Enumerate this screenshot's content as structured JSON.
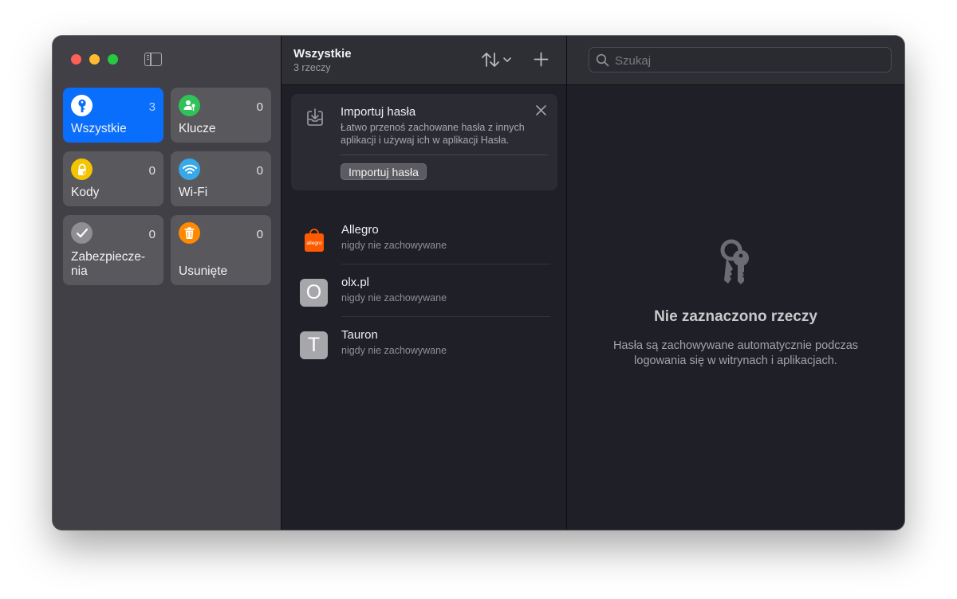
{
  "sidebar": {
    "tiles": [
      {
        "label": "Wszystkie",
        "count": "3",
        "icon": "key-icon",
        "color": "#0a6efc"
      },
      {
        "label": "Klucze",
        "count": "0",
        "icon": "passkey-person-icon",
        "color": "#30c259"
      },
      {
        "label": "Kody",
        "count": "0",
        "icon": "lock-icon",
        "color": "#f5c400"
      },
      {
        "label": "Wi-Fi",
        "count": "0",
        "icon": "wifi-icon",
        "color": "#38a9e8"
      },
      {
        "label": "Zabezpiecze-\nnia",
        "label_line1": "Zabezpiecze-",
        "label_line2": "nia",
        "count": "0",
        "icon": "checkmark-icon",
        "color": "#8e8e93"
      },
      {
        "label": "Usunięte",
        "count": "0",
        "icon": "trash-icon",
        "color": "#ff8a00"
      }
    ]
  },
  "list_header": {
    "title": "Wszystkie",
    "subtitle": "3 rzeczy"
  },
  "import_card": {
    "title": "Importuj hasła",
    "description": "Łatwo przenoś zachowane hasła z innych aplikacji i używaj ich w aplikacji Hasła.",
    "button_label": "Importuj hasła"
  },
  "items": [
    {
      "title": "Allegro",
      "subtitle": "nigdy nie zachowywane",
      "favicon_text": "allegro",
      "favicon_color": "#ff5a00"
    },
    {
      "title": "olx.pl",
      "subtitle": "nigdy nie zachowywane",
      "favicon_text": "O"
    },
    {
      "title": "Tauron",
      "subtitle": "nigdy nie zachowywane",
      "favicon_text": "T"
    }
  ],
  "search": {
    "placeholder": "Szukaj"
  },
  "detail": {
    "empty_title": "Nie zaznaczono rzeczy",
    "empty_desc_line1": "Hasła są zachowywane automatycznie podczas",
    "empty_desc_line2": "logowania się w witrynach i aplikacjach."
  }
}
